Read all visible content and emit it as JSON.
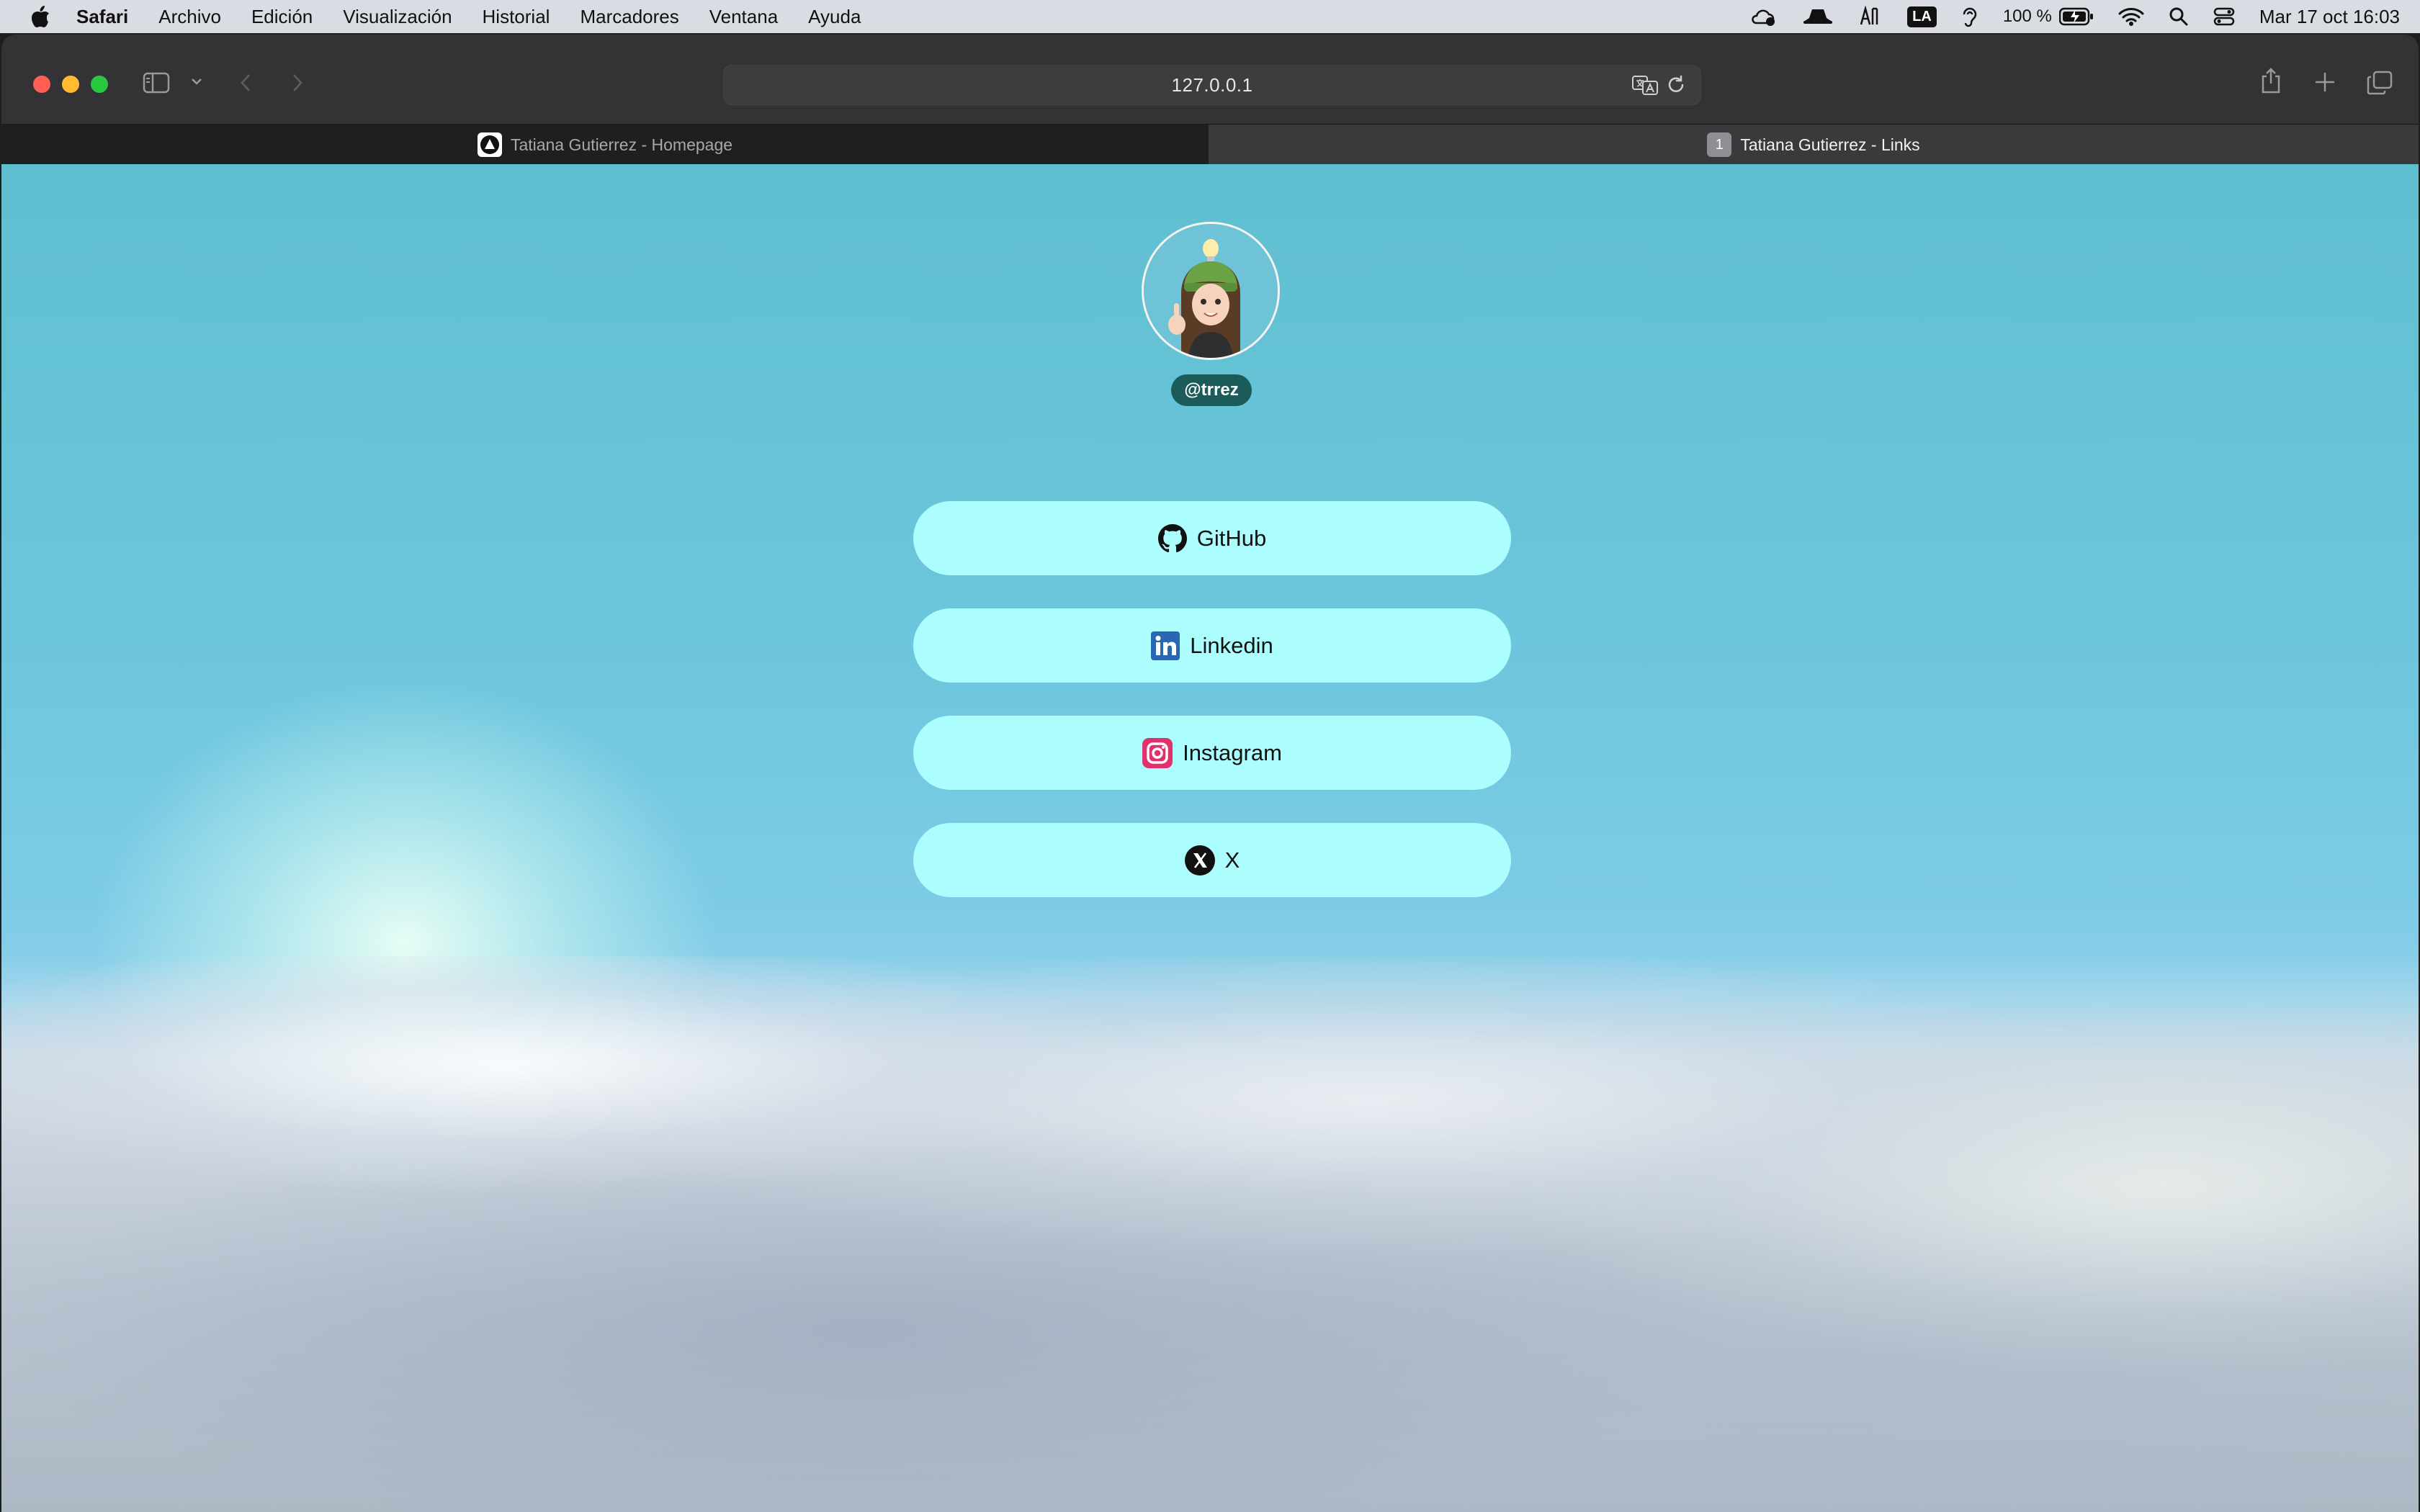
{
  "menubar": {
    "app_name": "Safari",
    "items": [
      "Archivo",
      "Edición",
      "Visualización",
      "Historial",
      "Marcadores",
      "Ventana",
      "Ayuda"
    ],
    "keyboard_layout": "LA",
    "battery": "100 %",
    "clock": "Mar 17 oct  16:03"
  },
  "browser": {
    "url": "127.0.0.1",
    "tabs": [
      {
        "title": "Tatiana Gutierrez - Homepage",
        "active": false
      },
      {
        "title": "Tatiana Gutierrez - Links",
        "active": true,
        "favicon_text": "1"
      }
    ]
  },
  "profile": {
    "handle": "@trrez"
  },
  "links": [
    {
      "label": "GitHub",
      "icon": "github-icon"
    },
    {
      "label": "Linkedin",
      "icon": "linkedin-icon"
    },
    {
      "label": "Instagram",
      "icon": "instagram-icon"
    },
    {
      "label": "X",
      "icon": "x-icon"
    }
  ],
  "colors": {
    "link_button_bg": "#acfdfe",
    "handle_bg": "#1b5c5b",
    "linkedin": "#2867b2",
    "instagram": "#e1306c"
  }
}
